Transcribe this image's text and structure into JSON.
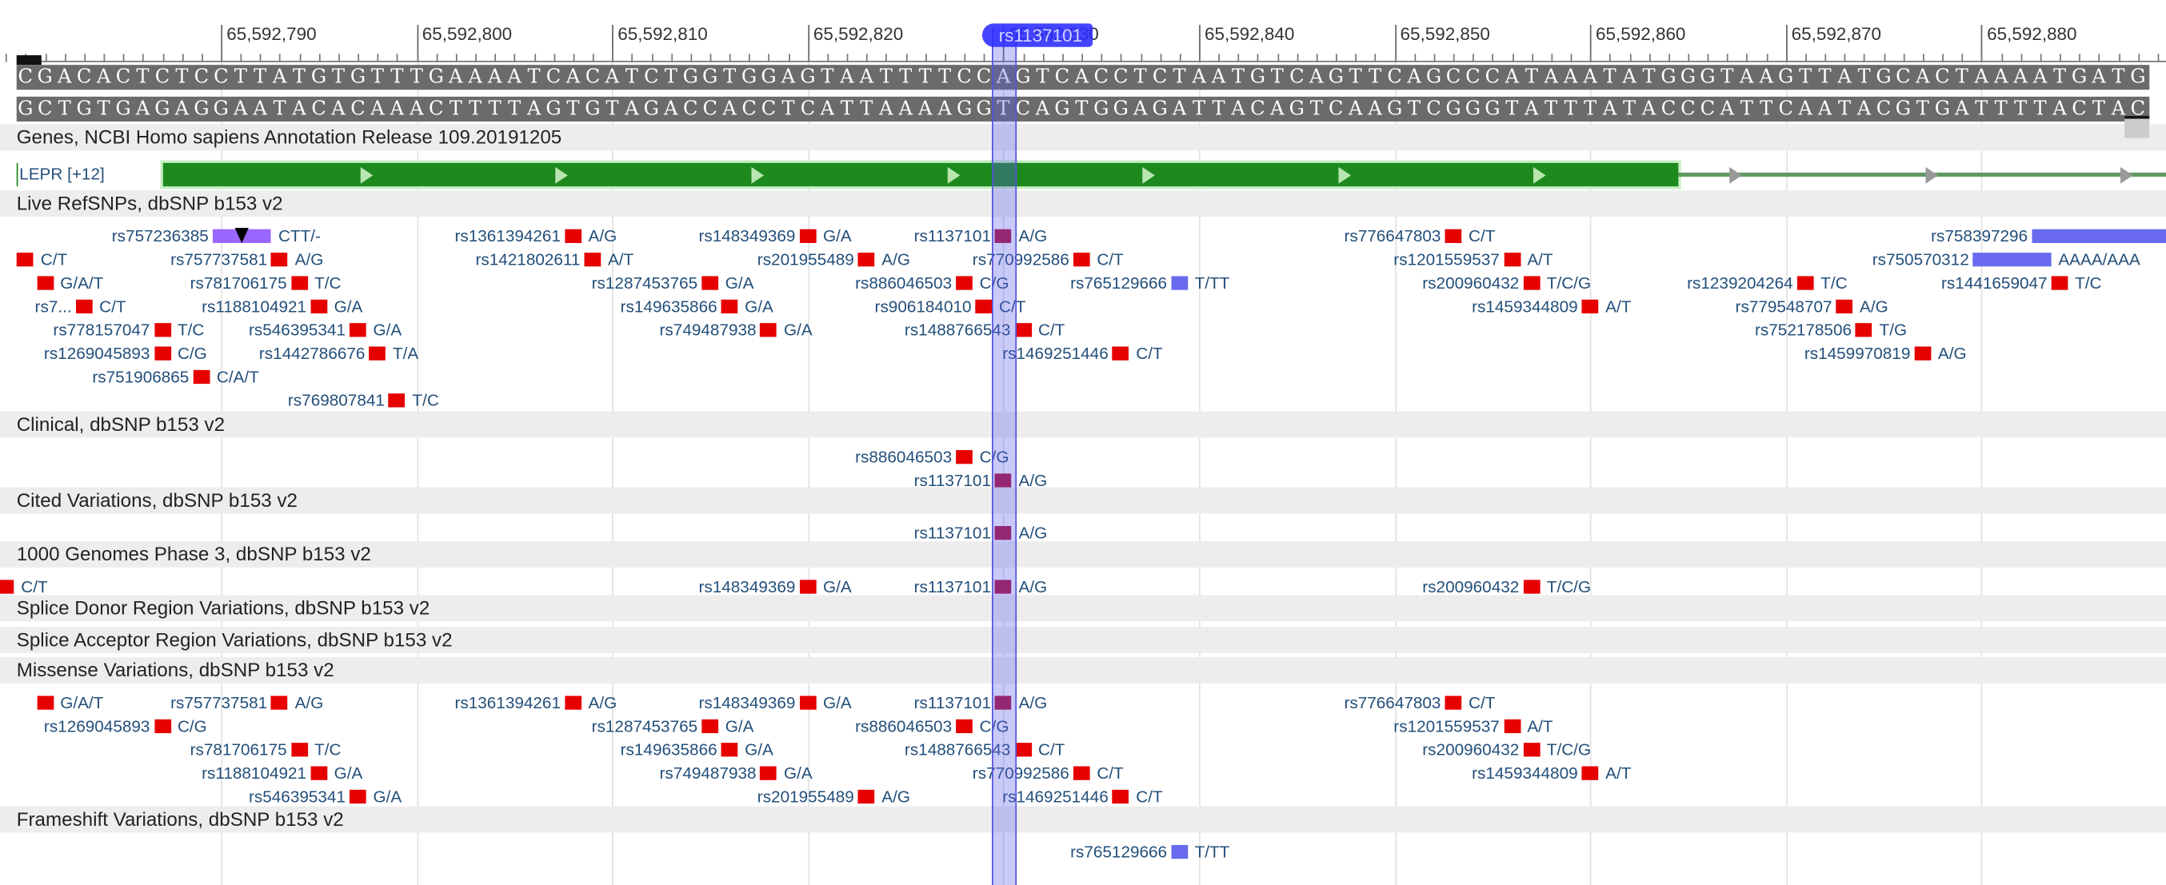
{
  "ruler": {
    "ticks": [
      "65,592,790",
      "65,592,800",
      "65,592,810",
      "65,592,820",
      "65,592,830",
      "65,592,840",
      "65,592,850",
      "65,592,860",
      "65,592,870",
      "65,592,880"
    ],
    "tick_positions": [
      65592790,
      65592800,
      65592810,
      65592820,
      65592830,
      65592840,
      65592850,
      65592860,
      65592870,
      65592880
    ]
  },
  "sequence": {
    "start": 65592780,
    "forward": "CGACACTCTCCTTATGTGTTTGAAAATCACATCTGGTGGAGTAATTTTCCAGTCACCTCTAATGTCAGTTCAGCCCATAAATATGGGTAAGTTATGCACTAAAATGATG",
    "reverse": "GCTGTGAGAGGAATACACAAACTTTTAGTGTAGACCACCTCATTAAAAGGTCAGTGGAGATTACAGTCAAGTCGGGTATTTATACCCATTCAATACGTGATTTTACTAC"
  },
  "highlight": {
    "label": "rs1137101",
    "pos": 65592830
  },
  "genes": {
    "title": "Genes, NCBI Homo sapiens Annotation Release 109.20191205",
    "gene_label": "LEPR [+12]",
    "exon_end": 65592864,
    "color": "#1e8a1e"
  },
  "colors": {
    "snv": "#e60000",
    "snv_highlight": "#b0103a",
    "ins": "#9966ff",
    "del": "#6a6af0"
  },
  "tracks": [
    {
      "title": "Live RefSNPs, dbSNP b153 v2",
      "rows": [
        [
          {
            "id": "rs757236385",
            "allele": "CTT/-",
            "pos": 65592790,
            "len": 3,
            "kind": "ins"
          },
          {
            "id": "rs1361394261",
            "allele": "A/G",
            "pos": 65592808
          },
          {
            "id": "rs148349369",
            "allele": "G/A",
            "pos": 65592820
          },
          {
            "id": "rs1137101",
            "allele": "A/G",
            "pos": 65592830
          },
          {
            "id": "rs776647803",
            "allele": "C/T",
            "pos": 65592853
          },
          {
            "id": "rs758397296",
            "allele": "",
            "pos": 65592883,
            "len": 8,
            "kind": "del"
          }
        ],
        [
          {
            "id": "",
            "allele": "C/T",
            "pos": 65592780
          },
          {
            "id": "rs757737581",
            "allele": "A/G",
            "pos": 65592793
          },
          {
            "id": "rs1421802611",
            "allele": "A/T",
            "pos": 65592809
          },
          {
            "id": "rs201955489",
            "allele": "A/G",
            "pos": 65592823
          },
          {
            "id": "rs770992586",
            "allele": "C/T",
            "pos": 65592834
          },
          {
            "id": "rs1201559537",
            "allele": "A/T",
            "pos": 65592856
          },
          {
            "id": "rs750570312",
            "allele": "AAAA/AAA",
            "pos": 65592880,
            "len": 4,
            "kind": "del"
          }
        ],
        [
          {
            "id": "",
            "allele": "G/A/T",
            "pos": 65592781
          },
          {
            "id": "rs781706175",
            "allele": "T/C",
            "pos": 65592794
          },
          {
            "id": "rs1287453765",
            "allele": "G/A",
            "pos": 65592815
          },
          {
            "id": "rs886046503",
            "allele": "C/G",
            "pos": 65592828
          },
          {
            "id": "rs765129666",
            "allele": "T/TT",
            "pos": 65592839,
            "kind": "del"
          },
          {
            "id": "rs200960432",
            "allele": "T/C/G",
            "pos": 65592857
          },
          {
            "id": "rs1239204264",
            "allele": "T/C",
            "pos": 65592871
          },
          {
            "id": "rs1441659047",
            "allele": "T/C",
            "pos": 65592884
          }
        ],
        [
          {
            "id": "rs7...",
            "allele": "C/T",
            "pos": 65592783
          },
          {
            "id": "rs1188104921",
            "allele": "G/A",
            "pos": 65592795
          },
          {
            "id": "rs149635866",
            "allele": "G/A",
            "pos": 65592816
          },
          {
            "id": "rs906184010",
            "allele": "C/T",
            "pos": 65592829
          },
          {
            "id": "rs1459344809",
            "allele": "A/T",
            "pos": 65592860
          },
          {
            "id": "rs779548707",
            "allele": "A/G",
            "pos": 65592873
          }
        ],
        [
          {
            "id": "rs778157047",
            "allele": "T/C",
            "pos": 65592787
          },
          {
            "id": "rs546395341",
            "allele": "G/A",
            "pos": 65592797
          },
          {
            "id": "rs749487938",
            "allele": "G/A",
            "pos": 65592818
          },
          {
            "id": "rs1488766543",
            "allele": "C/T",
            "pos": 65592831
          },
          {
            "id": "rs752178506",
            "allele": "T/G",
            "pos": 65592874
          }
        ],
        [
          {
            "id": "rs1269045893",
            "allele": "C/G",
            "pos": 65592787
          },
          {
            "id": "rs1442786676",
            "allele": "T/A",
            "pos": 65592798
          },
          {
            "id": "rs1469251446",
            "allele": "C/T",
            "pos": 65592836
          },
          {
            "id": "rs1459970819",
            "allele": "A/G",
            "pos": 65592877
          }
        ],
        [
          {
            "id": "rs751906865",
            "allele": "C/A/T",
            "pos": 65592789
          }
        ],
        [
          {
            "id": "rs769807841",
            "allele": "T/C",
            "pos": 65592799
          }
        ]
      ]
    },
    {
      "title": "Clinical, dbSNP b153 v2",
      "rows": [
        [
          {
            "id": "rs886046503",
            "allele": "C/G",
            "pos": 65592828
          }
        ],
        [
          {
            "id": "rs1137101",
            "allele": "A/G",
            "pos": 65592830
          }
        ]
      ]
    },
    {
      "title": "Cited Variations, dbSNP b153 v2",
      "rows": [
        [
          {
            "id": "rs1137101",
            "allele": "A/G",
            "pos": 65592830
          }
        ]
      ]
    },
    {
      "title": "1000 Genomes Phase 3, dbSNP b153 v2",
      "rows": [
        [
          {
            "id": "",
            "allele": "C/T",
            "pos": 65592779
          },
          {
            "id": "rs148349369",
            "allele": "G/A",
            "pos": 65592820
          },
          {
            "id": "rs1137101",
            "allele": "A/G",
            "pos": 65592830
          },
          {
            "id": "rs200960432",
            "allele": "T/C/G",
            "pos": 65592857
          }
        ]
      ]
    },
    {
      "title": "Splice Donor Region Variations, dbSNP b153 v2",
      "rows": []
    },
    {
      "title": "Splice Acceptor Region Variations, dbSNP b153 v2",
      "rows": []
    },
    {
      "title": "Missense Variations, dbSNP b153 v2",
      "rows": [
        [
          {
            "id": "",
            "allele": "G/A/T",
            "pos": 65592781
          },
          {
            "id": "rs757737581",
            "allele": "A/G",
            "pos": 65592793
          },
          {
            "id": "rs1361394261",
            "allele": "A/G",
            "pos": 65592808
          },
          {
            "id": "rs148349369",
            "allele": "G/A",
            "pos": 65592820
          },
          {
            "id": "rs1137101",
            "allele": "A/G",
            "pos": 65592830
          },
          {
            "id": "rs776647803",
            "allele": "C/T",
            "pos": 65592853
          }
        ],
        [
          {
            "id": "rs1269045893",
            "allele": "C/G",
            "pos": 65592787
          },
          {
            "id": "rs1287453765",
            "allele": "G/A",
            "pos": 65592815
          },
          {
            "id": "rs886046503",
            "allele": "C/G",
            "pos": 65592828
          },
          {
            "id": "rs1201559537",
            "allele": "A/T",
            "pos": 65592856
          }
        ],
        [
          {
            "id": "rs781706175",
            "allele": "T/C",
            "pos": 65592794
          },
          {
            "id": "rs149635866",
            "allele": "G/A",
            "pos": 65592816
          },
          {
            "id": "rs1488766543",
            "allele": "C/T",
            "pos": 65592831
          },
          {
            "id": "rs200960432",
            "allele": "T/C/G",
            "pos": 65592857
          }
        ],
        [
          {
            "id": "rs1188104921",
            "allele": "G/A",
            "pos": 65592795
          },
          {
            "id": "rs749487938",
            "allele": "G/A",
            "pos": 65592818
          },
          {
            "id": "rs770992586",
            "allele": "C/T",
            "pos": 65592834
          },
          {
            "id": "rs1459344809",
            "allele": "A/T",
            "pos": 65592860
          }
        ],
        [
          {
            "id": "rs546395341",
            "allele": "G/A",
            "pos": 65592797
          },
          {
            "id": "rs201955489",
            "allele": "A/G",
            "pos": 65592823
          },
          {
            "id": "rs1469251446",
            "allele": "C/T",
            "pos": 65592836
          }
        ]
      ]
    },
    {
      "title": "Frameshift Variations, dbSNP b153 v2",
      "rows": [
        [
          {
            "id": "rs765129666",
            "allele": "T/TT",
            "pos": 65592839,
            "kind": "del"
          }
        ]
      ]
    }
  ]
}
